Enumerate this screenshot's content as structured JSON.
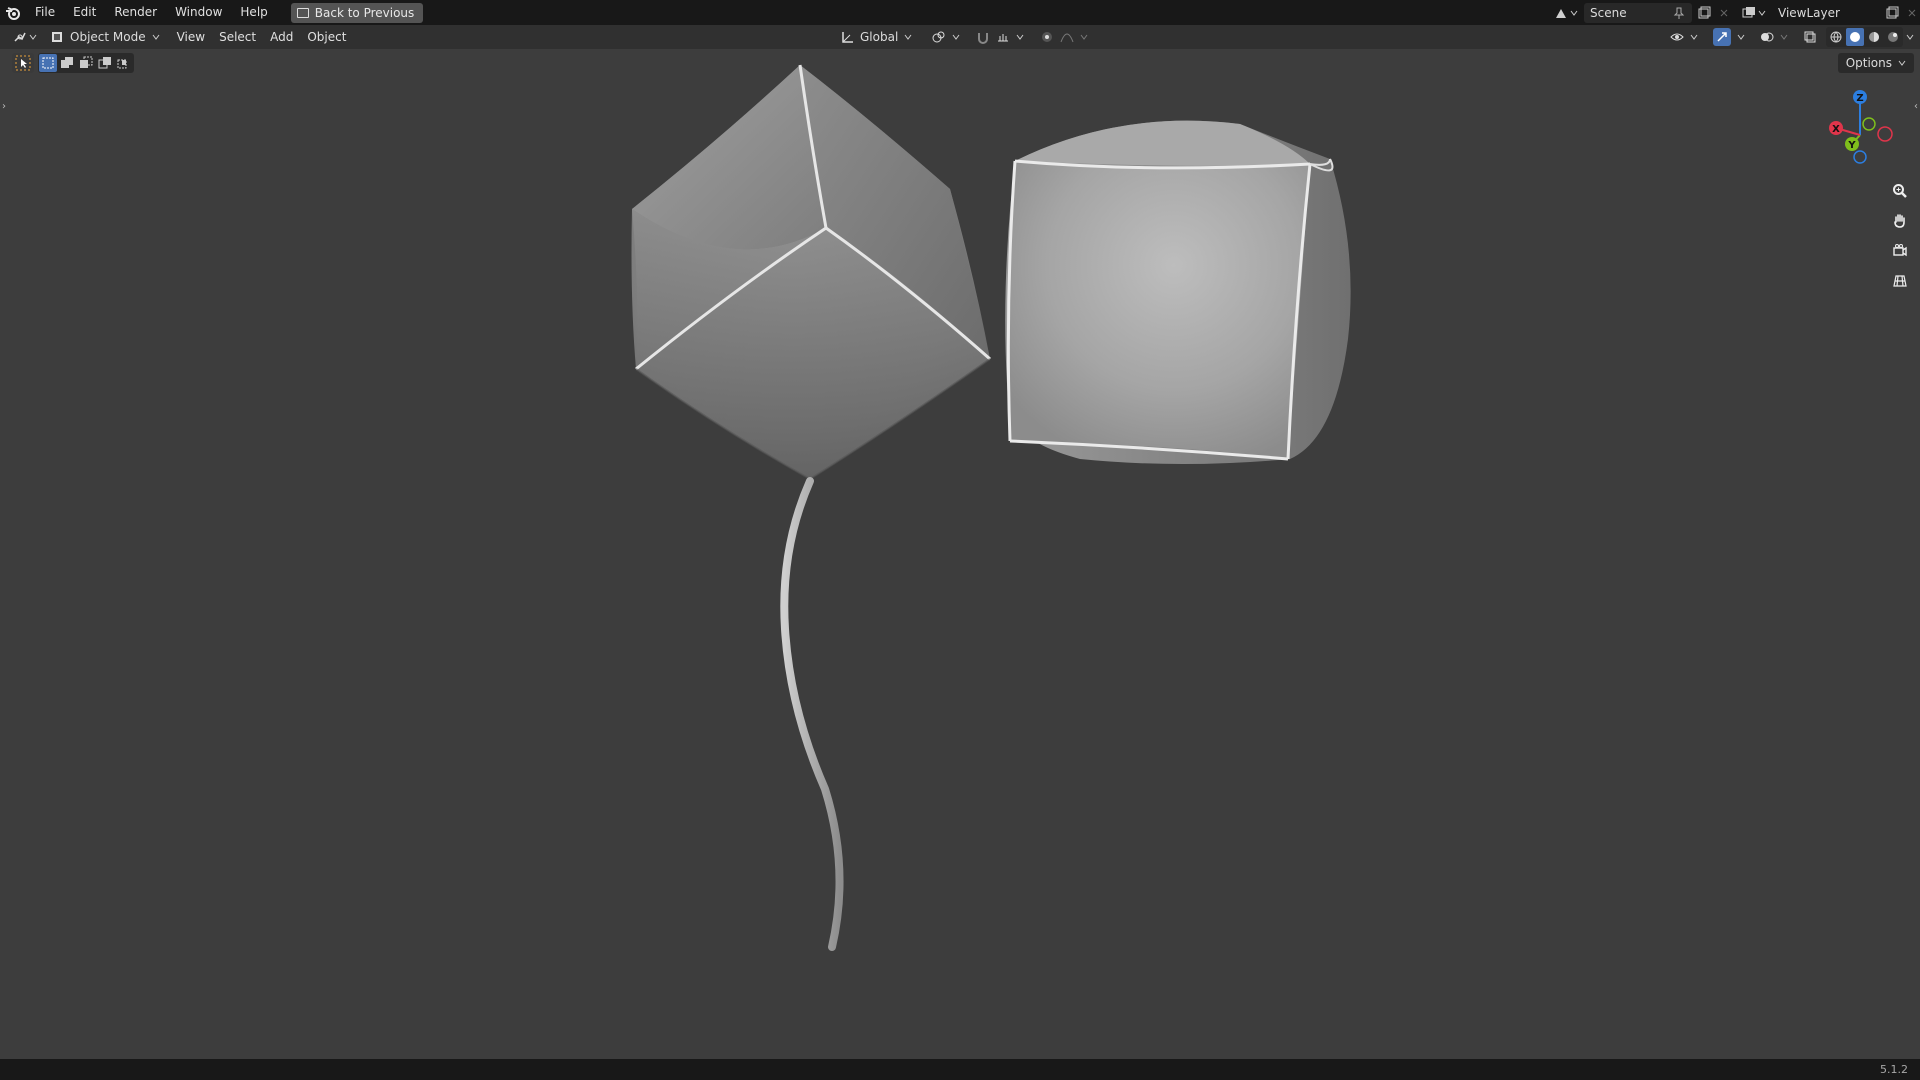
{
  "menu": {
    "items": [
      "File",
      "Edit",
      "Render",
      "Window",
      "Help"
    ],
    "back_button": "Back to Previous"
  },
  "topright": {
    "scene_label": "Scene",
    "view_layer_label": "ViewLayer"
  },
  "header": {
    "mode": "Object Mode",
    "menus": [
      "View",
      "Select",
      "Add",
      "Object"
    ],
    "transform_orientation": "Global"
  },
  "viewport": {
    "options_label": "Options",
    "gizmo": {
      "z": "Z",
      "y": "Y",
      "x": "X"
    }
  },
  "status": {
    "version": "5.1.2"
  },
  "colors": {
    "axis_x": "#e0354b",
    "axis_y": "#7fbf1c",
    "axis_z": "#2c7ee0",
    "accent": "#4772b3"
  },
  "icons": [
    "blender-logo-icon",
    "back-icon",
    "scene-icon",
    "pin-icon",
    "new-scene-icon",
    "close-icon",
    "view-layer-icon",
    "editor-type-icon",
    "object-mode-icon",
    "orientation-icon",
    "pivot-icon",
    "snap-icon",
    "proportional-edit-icon",
    "visibility-icon",
    "gizmo-icon",
    "overlay-icon",
    "xray-icon",
    "wireframe-shading-icon",
    "solid-shading-icon",
    "material-shading-icon",
    "rendered-shading-icon",
    "zoom-icon",
    "pan-hand-icon",
    "camera-view-icon",
    "ortho-grid-icon",
    "select-tool-icon"
  ]
}
